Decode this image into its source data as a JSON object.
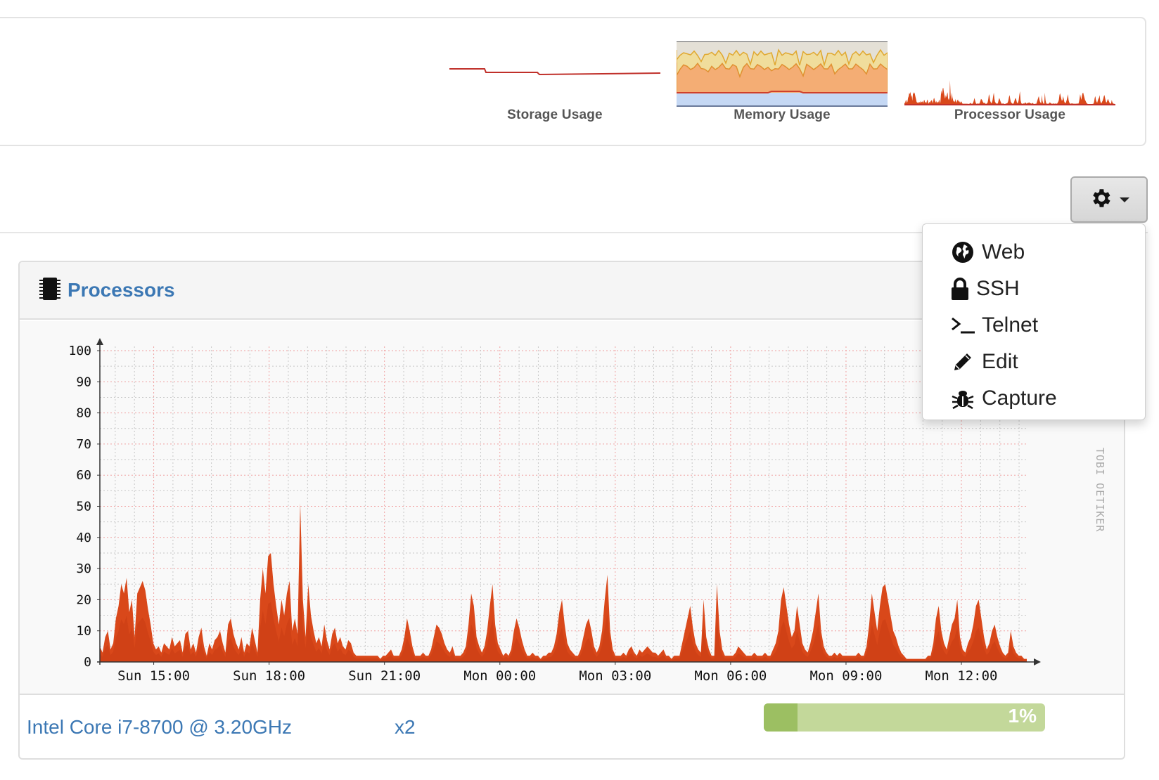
{
  "summary": {
    "storage_label": "Storage Usage",
    "memory_label": "Memory Usage",
    "processor_label": "Processor Usage"
  },
  "actions_menu": {
    "items": [
      {
        "label": "Web",
        "icon": "globe-icon"
      },
      {
        "label": "SSH",
        "icon": "lock-icon"
      },
      {
        "label": "Telnet",
        "icon": "terminal-icon"
      },
      {
        "label": "Edit",
        "icon": "pencil-icon"
      },
      {
        "label": "Capture",
        "icon": "bug-icon"
      }
    ]
  },
  "processors": {
    "title": "Processors",
    "cpu_name": "Intel Core i7-8700 @ 3.20GHz",
    "cpu_count": "x2",
    "usage_percent": 1,
    "usage_label": "1%",
    "watermark": "TOBI OETIKER"
  },
  "colors": {
    "link_blue": "#3c78b4",
    "area_orange": "#d9481a",
    "bar_green": "#9cbf62",
    "bar_track": "#c3d89a"
  },
  "chart_data": {
    "type": "area",
    "ylim": [
      0,
      100
    ],
    "yticks": [
      "0",
      "10",
      "20",
      "30",
      "40",
      "50",
      "60",
      "70",
      "80",
      "90",
      "100"
    ],
    "xticks": [
      "Sun 15:00",
      "Sun 18:00",
      "Sun 21:00",
      "Mon 00:00",
      "Mon 03:00",
      "Mon 06:00",
      "Mon 09:00",
      "Mon 12:00"
    ],
    "x_range_hours": [
      13.6,
      37.7
    ],
    "grid": true,
    "series": [
      {
        "values": [
          5,
          3,
          8,
          10,
          4,
          6,
          14,
          18,
          25,
          22,
          27,
          16,
          20,
          8,
          22,
          24,
          26,
          23,
          17,
          12,
          6,
          4,
          5,
          3,
          6,
          5,
          4,
          8,
          5,
          6,
          7,
          3,
          9,
          10,
          4,
          6,
          3,
          8,
          11,
          5,
          2,
          6,
          4,
          7,
          8,
          10,
          6,
          3,
          12,
          14,
          9,
          6,
          4,
          8,
          3,
          6,
          5,
          11,
          7,
          3,
          20,
          30,
          22,
          34,
          35,
          25,
          18,
          12,
          20,
          15,
          22,
          26,
          10,
          14,
          9,
          51,
          20,
          8,
          25,
          15,
          10,
          6,
          8,
          5,
          12,
          7,
          4,
          9,
          11,
          6,
          8,
          5,
          4,
          7,
          6,
          3,
          2,
          2,
          2,
          2,
          2,
          2,
          2,
          2,
          2,
          1,
          2,
          2,
          3,
          4,
          2,
          2,
          2,
          4,
          8,
          14,
          10,
          5,
          2,
          2,
          2,
          3,
          2,
          2,
          4,
          8,
          12,
          11,
          9,
          6,
          4,
          3,
          5,
          2,
          2,
          2,
          3,
          5,
          12,
          22,
          18,
          8,
          5,
          3,
          5,
          10,
          18,
          25,
          12,
          6,
          4,
          2,
          3,
          2,
          4,
          10,
          14,
          11,
          7,
          4,
          2,
          2,
          3,
          2,
          2,
          1,
          2,
          2,
          3,
          3,
          5,
          9,
          16,
          20,
          12,
          6,
          4,
          3,
          2,
          2,
          4,
          8,
          12,
          14,
          10,
          5,
          3,
          5,
          10,
          20,
          28,
          10,
          4,
          2,
          2,
          2,
          3,
          2,
          4,
          5,
          3,
          2,
          4,
          3,
          4,
          5,
          4,
          3,
          3,
          2,
          3,
          4,
          2,
          2,
          1,
          2,
          2,
          2,
          6,
          10,
          14,
          18,
          11,
          6,
          4,
          3,
          20,
          8,
          4,
          2,
          2,
          25,
          10,
          4,
          2,
          2,
          2,
          2,
          3,
          5,
          4,
          3,
          2,
          2,
          2,
          3,
          2,
          2,
          2,
          3,
          2,
          2,
          4,
          6,
          10,
          20,
          24,
          18,
          12,
          8,
          10,
          18,
          12,
          6,
          4,
          3,
          6,
          10,
          16,
          22,
          10,
          5,
          3,
          2,
          2,
          3,
          2,
          3,
          2,
          2,
          2,
          2,
          2,
          2,
          3,
          2,
          2,
          5,
          12,
          22,
          16,
          10,
          18,
          24,
          25,
          20,
          15,
          10,
          8,
          5,
          3,
          2,
          1,
          1,
          1,
          1,
          1,
          1,
          1,
          1,
          2,
          2,
          6,
          14,
          18,
          10,
          6,
          4,
          8,
          12,
          14,
          20,
          8,
          4,
          3,
          6,
          8,
          12,
          18,
          20,
          14,
          8,
          4,
          6,
          10,
          12,
          8,
          5,
          3,
          2,
          3,
          10,
          5,
          3,
          2,
          2,
          1,
          1
        ]
      }
    ]
  }
}
